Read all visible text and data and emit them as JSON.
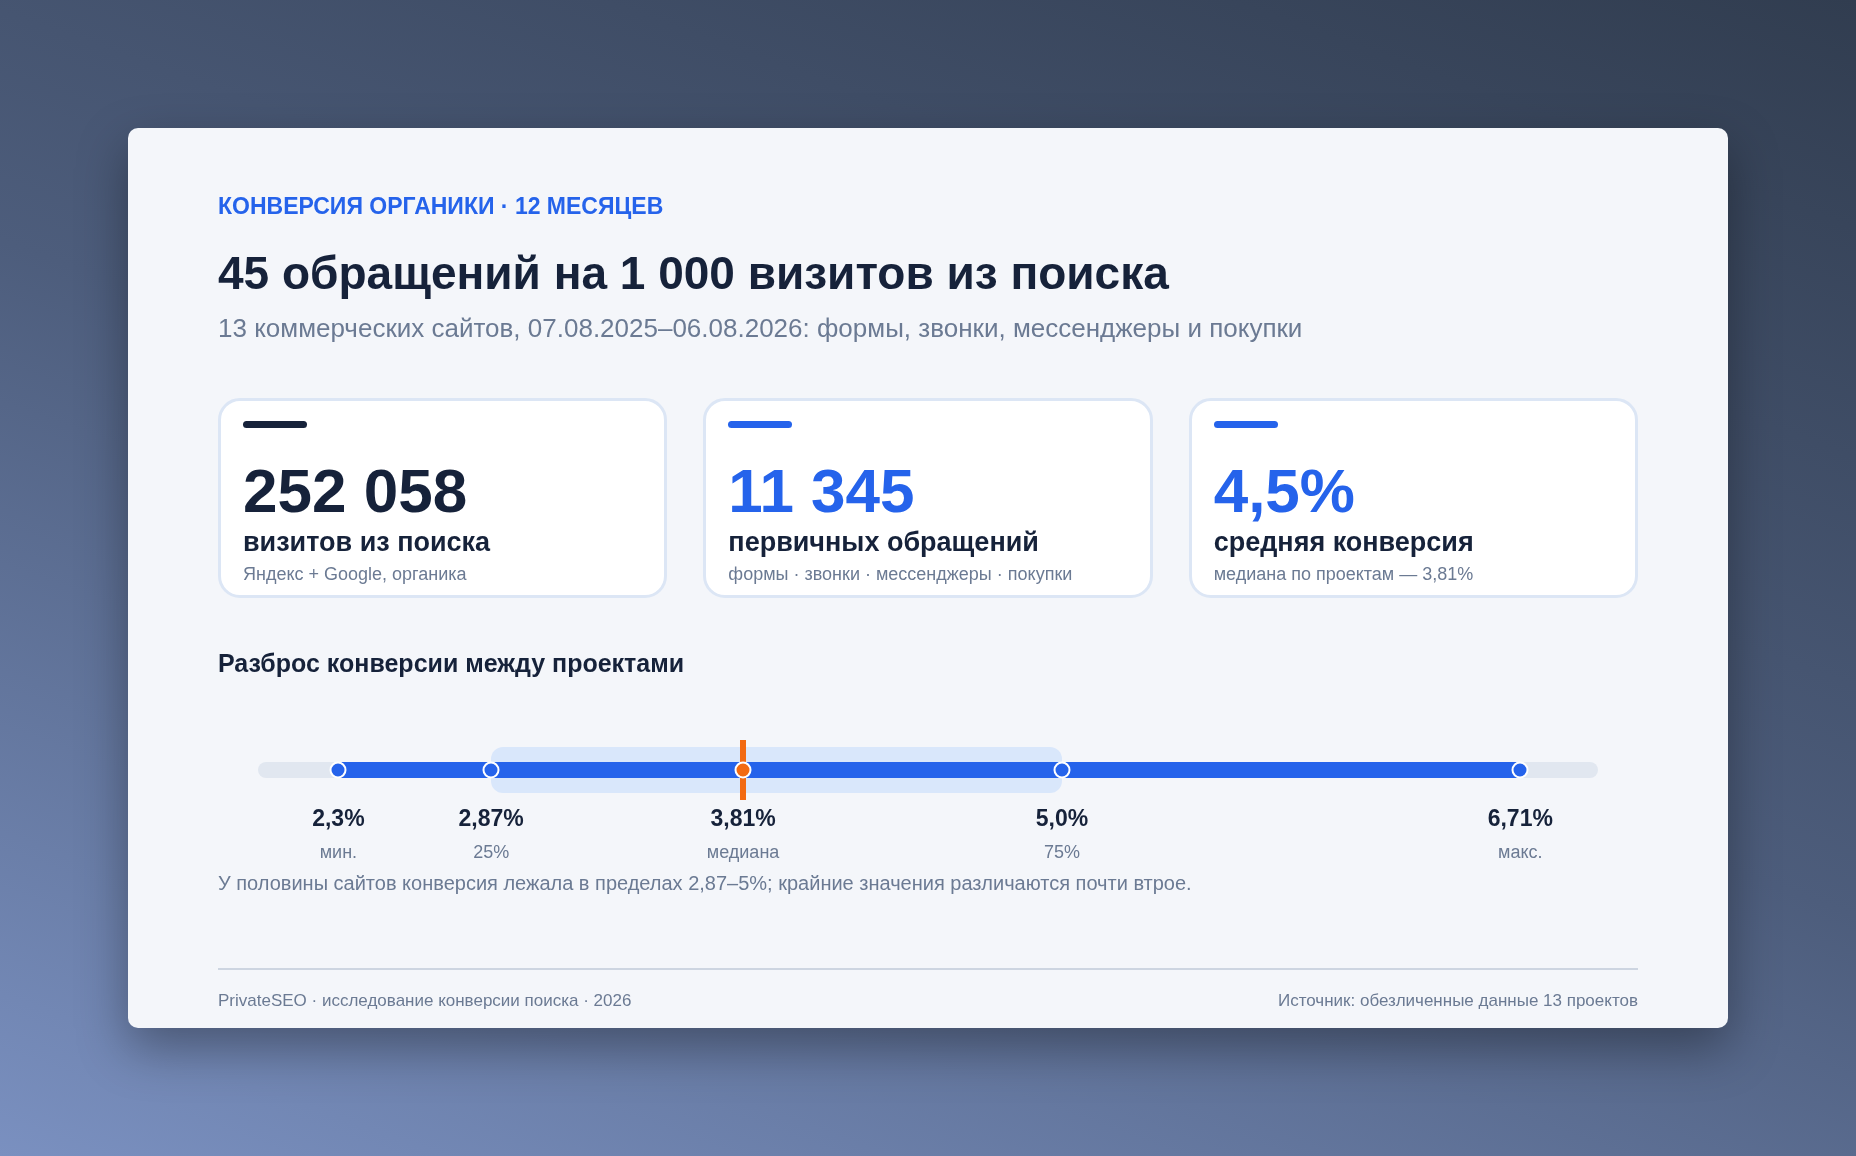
{
  "eyebrow": "КОНВЕРСИЯ ОРГАНИКИ · 12 МЕСЯЦЕВ",
  "title": "45 обращений на 1 000 визитов из поиска",
  "subtitle": "13 коммерческих сайтов, 07.08.2025–06.08.2026: формы, звонки, мессенджеры и покупки",
  "stats": [
    {
      "value": "252 058",
      "label": "визитов из поиска",
      "note": "Яндекс + Google, органика",
      "color": "#16223a"
    },
    {
      "value": "11 345",
      "label": "первичных обращений",
      "note": "формы · звонки · мессенджеры · покупки",
      "color": "#2563eb"
    },
    {
      "value": "4,5%",
      "label": "средняя конверсия",
      "note": "медиана по проектам — 3,81%",
      "color": "#2563eb"
    }
  ],
  "spread": {
    "title": "Разброс конверсии между проектами",
    "markers": [
      {
        "kind": "end",
        "level": 0.06,
        "value": "2,3%",
        "caption": "мин."
      },
      {
        "kind": "quartile",
        "level": 0.174,
        "value": "2,87%",
        "caption": "25%"
      },
      {
        "kind": "median",
        "level": 0.362,
        "value": "3,81%",
        "caption": "медиана"
      },
      {
        "kind": "quartile",
        "level": 0.6,
        "value": "5,0%",
        "caption": "75%"
      },
      {
        "kind": "end",
        "level": 0.942,
        "value": "6,71%",
        "caption": "макс."
      }
    ],
    "note": "У половины сайтов конверсия лежала в пределах 2,87–5%; крайние значения различаются почти втрое."
  },
  "footer": {
    "left": "PrivateSEO · исследование конверсии поиска · 2026",
    "right": "Источник: обезличенные данные 13 проектов"
  }
}
